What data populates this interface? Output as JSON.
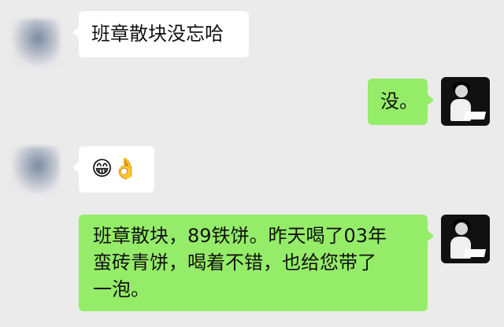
{
  "conversation": {
    "messages": [
      {
        "side": "left",
        "text": "班章散块没忘哈",
        "avatar_icon": "blurred-contact-avatar-icon"
      },
      {
        "side": "right",
        "text": "没。",
        "avatar_icon": "user-avatar-icon"
      },
      {
        "side": "left",
        "emoji": [
          "😁",
          "👌"
        ],
        "avatar_icon": "blurred-contact-avatar-icon"
      },
      {
        "side": "right",
        "lines": [
          "班章散块，89铁饼。昨天喝了03年",
          "蛮砖青饼，喝着不错，也给您带了",
          "一泡。"
        ],
        "avatar_icon": "user-avatar-icon"
      }
    ]
  },
  "colors": {
    "background": "#ebebeb",
    "incoming_bubble": "#ffffff",
    "outgoing_bubble": "#95ec69"
  }
}
